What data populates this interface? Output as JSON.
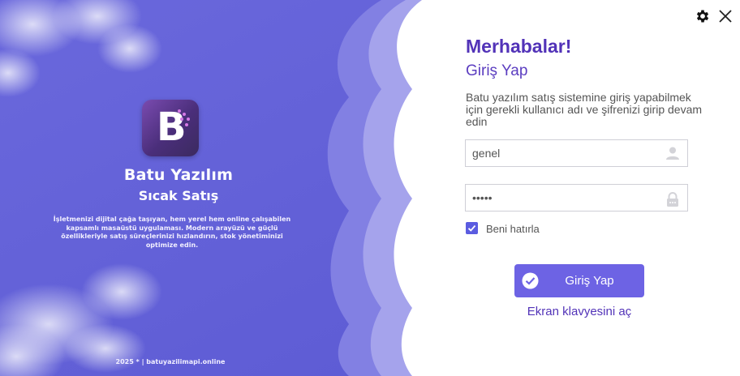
{
  "brand": {
    "logo_letter": "B",
    "title": "Batu Yazılım",
    "subtitle": "Sıcak Satış",
    "description": "İşletmenizi dijital çağa taşıyan, hem yerel hem online çalışabilen kapsamlı masaüstü uygulaması. Modern arayüzü ve güçlü özellikleriyle satış süreçlerinizi hızlandırın, stok yönetiminizi optimize edin.",
    "footer": "2025 * | batuyazilimapi.online"
  },
  "window_controls": {
    "settings_icon": "gear-icon",
    "close_icon": "close-icon"
  },
  "login": {
    "welcome": "Merhabalar!",
    "heading": "Giriş Yap",
    "instructions": "Batu yazılım satış sistemine giriş yapabilmek için gerekli kullanıcı adı ve şifrenizi girip devam edin",
    "username_value": "genel",
    "username_icon": "user-icon",
    "password_value": "•••••",
    "password_icon": "lock-icon",
    "remember_label": "Beni hatırla",
    "remember_checked": true,
    "button_label": "Giriş Yap",
    "keyboard_link": "Ekran klavyesini aç"
  },
  "colors": {
    "panel_blue": "#5f5fd6",
    "accent_purple": "#5233b8",
    "button": "#6d63e4",
    "checkbox": "#5b5ce0"
  }
}
